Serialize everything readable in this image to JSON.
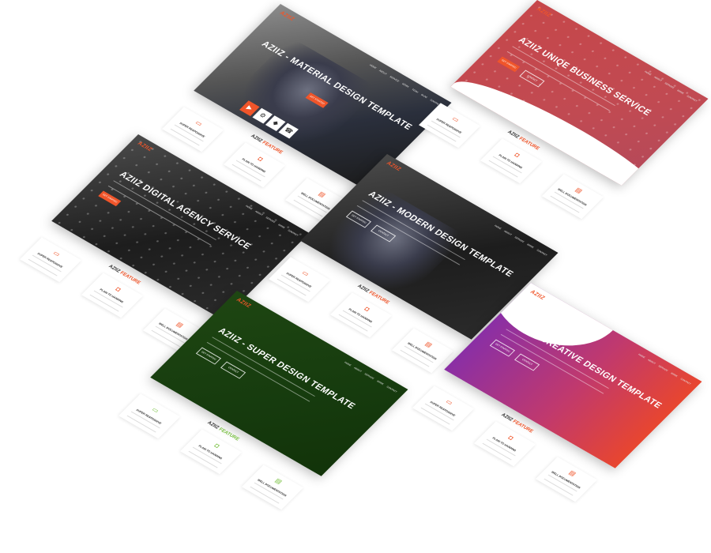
{
  "brand": {
    "logo": "AZIIZ",
    "accent": "#f0552a",
    "green_accent": "#7ac143"
  },
  "nav_items": [
    "HOME",
    "ABOUT",
    "SERVICE",
    "WORK",
    "TEAM",
    "BLOG",
    "CONTACT"
  ],
  "feature_labels": {
    "prefix": "AZIIZ",
    "highlight": "FEATURE"
  },
  "feature_cards": [
    "SUPER RESPONSIVE",
    "PLAIN TO HANDING",
    "WELL DOCUMENTATION"
  ],
  "buttons": {
    "primary": "GET STARTED",
    "secondary": "CONTACT"
  },
  "icons": [
    "play-icon",
    "gear-icon",
    "cart-icon",
    "phone-icon"
  ],
  "templates": [
    {
      "id": "material",
      "hero": "AZIIZ - MATERIAL DESIGN TEMPLATE",
      "style": "photo"
    },
    {
      "id": "business",
      "hero": "AZIIZ UNIQE BUSINESS SERVICE",
      "style": "red"
    },
    {
      "id": "agency",
      "hero": "AZIIZ DIGITAL AGENCY SERVICE",
      "style": "dark"
    },
    {
      "id": "modern",
      "hero": "AZIIZ - MODERN DESIGN TEMPLATE",
      "style": "dark"
    },
    {
      "id": "super",
      "hero": "AZIIZ - SUPER DESIGN TEMPLATE",
      "style": "green"
    },
    {
      "id": "creative",
      "hero": "AZIIZ - CREATIVE DESIGN TEMPLATE",
      "style": "purple"
    }
  ]
}
